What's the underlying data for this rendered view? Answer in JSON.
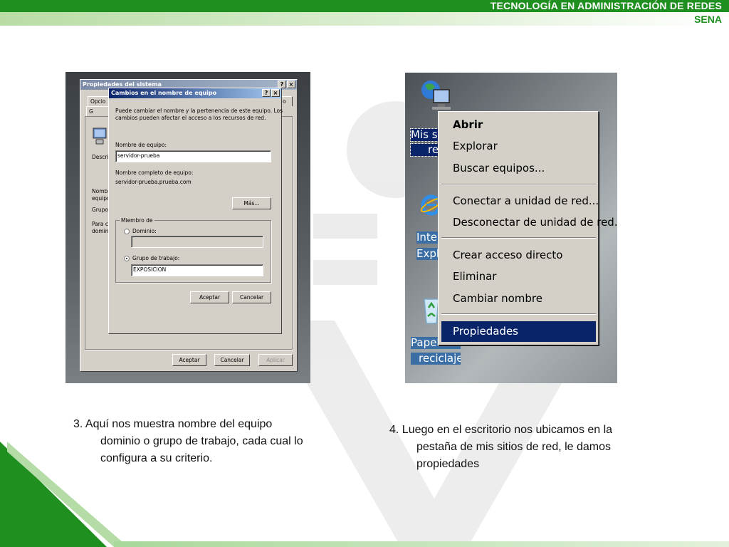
{
  "banner": {
    "title": "TECNOLOGÍA EN ADMINISTRACIÓN DE REDES",
    "subtitle": "SENA"
  },
  "colors": {
    "brand_green": "#1f8f1f",
    "xp_title_blue": "#0a246a",
    "menu_highlight": "#0a246a"
  },
  "shot1": {
    "back_window": {
      "title": "Propiedades del sistema",
      "help_glyph": "?",
      "close_glyph": "×",
      "tabs": [
        "Opcio",
        "o",
        "G"
      ],
      "labels": [
        "Descri",
        "Nombr",
        "equipo",
        "Grupo",
        "Para c",
        "domini"
      ],
      "buttons": {
        "accept": "Aceptar",
        "cancel": "Cancelar",
        "apply": "Aplicar"
      }
    },
    "dialog": {
      "title": "Cambios en el nombre de equipo",
      "help_glyph": "?",
      "close_glyph": "×",
      "intro_line1": "Puede cambiar el nombre y la pertenencia de este equipo. Los",
      "intro_line2": "cambios pueden afectar el acceso a los recursos de red.",
      "computer_name_label": "Nombre de equipo:",
      "computer_name_value": "servidor-prueba",
      "full_name_label": "Nombre completo de equipo:",
      "full_name_value": "servidor-prueba.prueba.com",
      "more_button": "Más...",
      "member_of": "Miembro de",
      "domain_label": "Dominio:",
      "domain_value": "",
      "workgroup_label": "Grupo de trabajo:",
      "workgroup_value": "EXPOSICION",
      "ok_button": "Aceptar",
      "cancel_button": "Cancelar"
    }
  },
  "shot2": {
    "desktop_icons": [
      {
        "label_line1": "Mis siti",
        "label_line2": "re",
        "icon": "network-places-icon"
      },
      {
        "label_line1": "Inter",
        "label_line2": "Explo",
        "icon": "internet-explorer-icon"
      },
      {
        "label_line1": "Papelera de",
        "label_line2": "reciclaje",
        "icon": "recycle-bin-icon"
      }
    ],
    "context_menu": {
      "open": "Abrir",
      "explore": "Explorar",
      "search": "Buscar equipos...",
      "map_drive": "Conectar a unidad de red...",
      "disconnect_drive": "Desconectar de unidad de red...",
      "create_shortcut": "Crear acceso directo",
      "delete": "Eliminar",
      "rename": "Cambiar nombre",
      "properties": "Propiedades"
    }
  },
  "captions": {
    "step3_line1": "3. Aquí nos muestra nombre del equipo",
    "step3_line2": "dominio o grupo de trabajo, cada cual lo",
    "step3_line3": "configura a su criterio.",
    "step4_line1": "4. Luego en el escritorio nos ubicamos en la",
    "step4_line2": "pestaña de mis sitios de red, le damos",
    "step4_line3": "propiedades"
  }
}
